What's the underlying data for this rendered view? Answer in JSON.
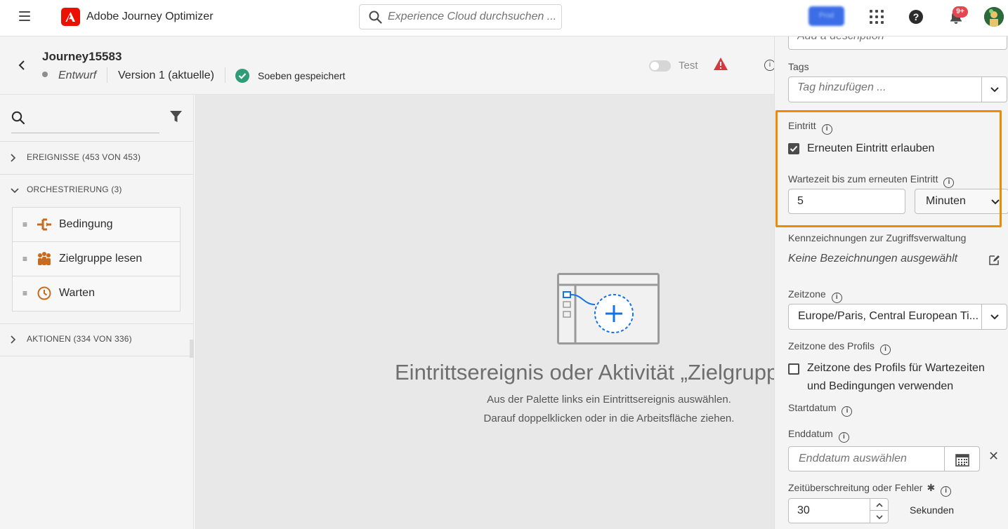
{
  "app": {
    "title": "Adobe Journey Optimizer",
    "search_placeholder": "Experience Cloud durchsuchen ...",
    "org_chip": "Prod",
    "notifications_badge": "9+"
  },
  "journey": {
    "name": "Journey15583",
    "status": "Entwurf",
    "version": "Version 1 (aktuelle)",
    "saved_status": "Soeben gespeichert",
    "test_label": "Test"
  },
  "palette": {
    "sections": [
      {
        "label": "EREIGNISSE (453 VON 453)"
      },
      {
        "label": "ORCHESTRIERUNG (3)"
      },
      {
        "label": "AKTIONEN (334 VON 336)"
      }
    ],
    "items": [
      {
        "label": "Bedingung",
        "icon": "condition-icon"
      },
      {
        "label": "Zielgruppe lesen",
        "icon": "audience-icon"
      },
      {
        "label": "Warten",
        "icon": "clock-icon"
      }
    ]
  },
  "canvas": {
    "empty_title": "Eintrittsereignis oder Aktivität „Zielgruppe lesen“ hinzufügen",
    "empty_line1": "Aus der Palette links ein Eintrittsereignis auswählen.",
    "empty_line2": "Darauf doppelklicken oder in die Arbeitsfläche ziehen."
  },
  "properties": {
    "description_placeholder": "Add a description",
    "tags_label": "Tags",
    "tags_placeholder": "Tag hinzufügen ...",
    "entry_label": "Eintritt",
    "reentry_checkbox": "Erneuten Eintritt erlauben",
    "reentry_checked": true,
    "wait_label": "Wartezeit bis zum erneuten Eintritt",
    "wait_value": "5",
    "wait_unit": "Minuten",
    "access_label": "Kennzeichnungen zur Zugriffsverwaltung",
    "access_value": "Keine Bezeichnungen ausgewählt",
    "timezone_label": "Zeitzone",
    "timezone_value": "Europe/Paris, Central European Ti...",
    "profile_tz_label": "Zeitzone des Profils",
    "profile_tz_checkbox_line1": "Zeitzone des Profils für Wartezeiten",
    "profile_tz_checkbox_line2": "und Bedingungen verwenden",
    "profile_tz_checked": false,
    "start_label": "Startdatum",
    "end_label": "Enddatum",
    "end_placeholder": "Enddatum auswählen",
    "timeout_label": "Zeitüberschreitung oder Fehler",
    "timeout_value": "30",
    "timeout_unit": "Sekunden"
  },
  "colors": {
    "brand_red": "#eb1000",
    "highlight_orange": "#f08a00",
    "palette_icon": "#c86b1e",
    "accent_blue": "#1473e6",
    "saved_green": "#2d9d78",
    "warning_red": "#d7373f"
  }
}
